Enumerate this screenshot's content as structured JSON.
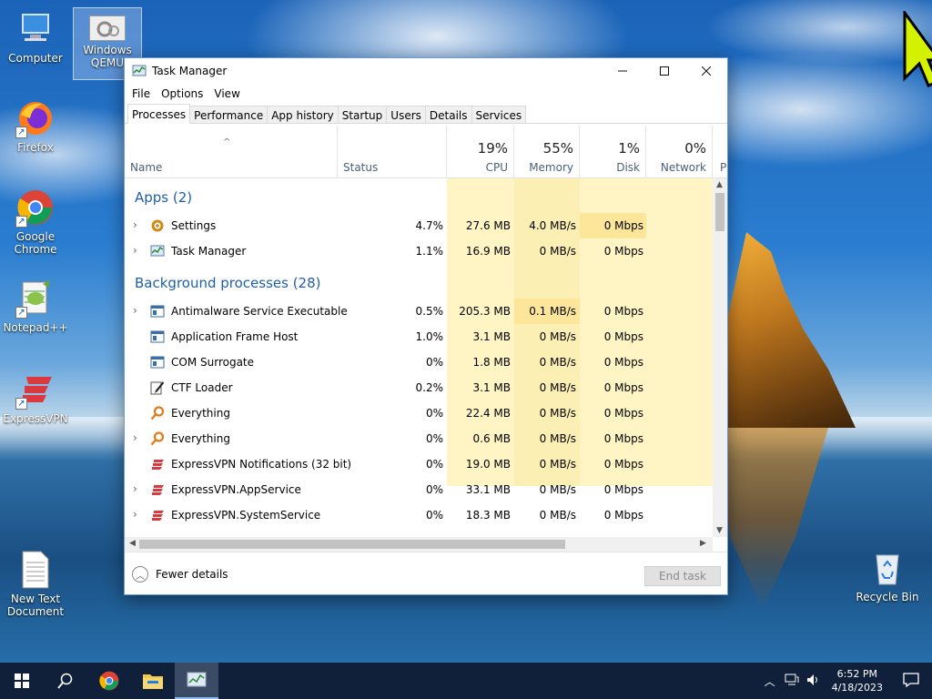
{
  "desktop": {
    "icons": [
      {
        "label": "Computer"
      },
      {
        "label": "Windows QEMU"
      },
      {
        "label": "Firefox"
      },
      {
        "label": "Google Chrome"
      },
      {
        "label": "Notepad++"
      },
      {
        "label": "ExpressVPN"
      },
      {
        "label": "New Text Document"
      },
      {
        "label": "Recycle Bin"
      }
    ]
  },
  "window": {
    "title": "Task Manager",
    "menu": [
      "File",
      "Options",
      "View"
    ],
    "tabs": [
      "Processes",
      "Performance",
      "App history",
      "Startup",
      "Users",
      "Details",
      "Services"
    ],
    "active_tab": "Processes",
    "columns": {
      "name": "Name",
      "status": "Status",
      "cpu": {
        "pct": "19%",
        "label": "CPU"
      },
      "memory": {
        "pct": "55%",
        "label": "Memory"
      },
      "disk": {
        "pct": "1%",
        "label": "Disk"
      },
      "network": {
        "pct": "0%",
        "label": "Network"
      },
      "power_partial": "P"
    },
    "groups": {
      "apps": "Apps (2)",
      "background": "Background processes (28)"
    },
    "apps": [
      {
        "name": "Settings",
        "icon": "gear-icon",
        "expandable": true,
        "cpu": "4.7%",
        "memory": "27.6 MB",
        "disk": "4.0 MB/s",
        "network": "0 Mbps"
      },
      {
        "name": "Task Manager",
        "icon": "task-manager-icon",
        "expandable": true,
        "cpu": "1.1%",
        "memory": "16.9 MB",
        "disk": "0 MB/s",
        "network": "0 Mbps"
      }
    ],
    "background": [
      {
        "name": "Antimalware Service Executable",
        "icon": "service-window-icon",
        "expandable": true,
        "cpu": "0.5%",
        "memory": "205.3 MB",
        "disk": "0.1 MB/s",
        "network": "0 Mbps"
      },
      {
        "name": "Application Frame Host",
        "icon": "service-window-icon",
        "expandable": false,
        "cpu": "1.0%",
        "memory": "3.1 MB",
        "disk": "0 MB/s",
        "network": "0 Mbps"
      },
      {
        "name": "COM Surrogate",
        "icon": "service-window-icon",
        "expandable": false,
        "cpu": "0%",
        "memory": "1.8 MB",
        "disk": "0 MB/s",
        "network": "0 Mbps"
      },
      {
        "name": "CTF Loader",
        "icon": "pen-icon",
        "expandable": false,
        "cpu": "0.2%",
        "memory": "3.1 MB",
        "disk": "0 MB/s",
        "network": "0 Mbps"
      },
      {
        "name": "Everything",
        "icon": "magnifier-icon",
        "expandable": false,
        "cpu": "0%",
        "memory": "22.4 MB",
        "disk": "0 MB/s",
        "network": "0 Mbps"
      },
      {
        "name": "Everything",
        "icon": "magnifier-icon",
        "expandable": true,
        "cpu": "0%",
        "memory": "0.6 MB",
        "disk": "0 MB/s",
        "network": "0 Mbps"
      },
      {
        "name": "ExpressVPN Notifications (32 bit)",
        "icon": "expressvpn-icon",
        "expandable": false,
        "cpu": "0%",
        "memory": "19.0 MB",
        "disk": "0 MB/s",
        "network": "0 Mbps"
      },
      {
        "name": "ExpressVPN.AppService",
        "icon": "expressvpn-icon",
        "expandable": true,
        "cpu": "0%",
        "memory": "33.1 MB",
        "disk": "0 MB/s",
        "network": "0 Mbps"
      },
      {
        "name": "ExpressVPN.SystemService",
        "icon": "expressvpn-icon",
        "expandable": true,
        "cpu": "0%",
        "memory": "18.3 MB",
        "disk": "0 MB/s",
        "network": "0 Mbps"
      }
    ],
    "footer": {
      "fewer_details": "Fewer details",
      "end_task": "End task"
    }
  },
  "taskbar": {
    "time": "6:52 PM",
    "date": "4/18/2023"
  },
  "colors": {
    "cpu_heavy": "#fde69a",
    "light": "#fff4c4",
    "accent": "#1f5fa8",
    "taskbar": "#10203a"
  }
}
